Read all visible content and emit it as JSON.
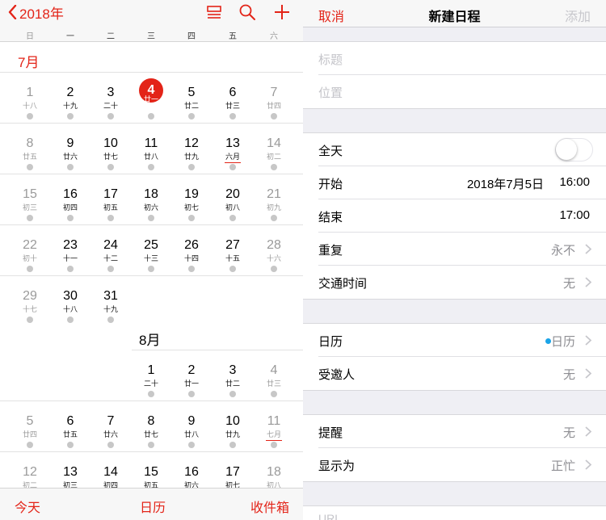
{
  "calendar": {
    "back_label": "2018年",
    "accent": "#e32418",
    "weekdays": [
      "日",
      "一",
      "二",
      "三",
      "四",
      "五",
      "六"
    ],
    "months": {
      "jul": "7月",
      "aug": "8月"
    },
    "july": [
      {
        "n": "1",
        "l": "十八"
      },
      {
        "n": "2",
        "l": "十九"
      },
      {
        "n": "3",
        "l": "二十"
      },
      {
        "n": "4",
        "l": "廿一"
      },
      {
        "n": "5",
        "l": "廿二"
      },
      {
        "n": "6",
        "l": "廿三"
      },
      {
        "n": "7",
        "l": "廿四"
      },
      {
        "n": "8",
        "l": "廿五"
      },
      {
        "n": "9",
        "l": "廿六"
      },
      {
        "n": "10",
        "l": "廿七"
      },
      {
        "n": "11",
        "l": "廿八"
      },
      {
        "n": "12",
        "l": "廿九"
      },
      {
        "n": "13",
        "l": "六月"
      },
      {
        "n": "14",
        "l": "初二"
      },
      {
        "n": "15",
        "l": "初三"
      },
      {
        "n": "16",
        "l": "初四"
      },
      {
        "n": "17",
        "l": "初五"
      },
      {
        "n": "18",
        "l": "初六"
      },
      {
        "n": "19",
        "l": "初七"
      },
      {
        "n": "20",
        "l": "初八"
      },
      {
        "n": "21",
        "l": "初九"
      },
      {
        "n": "22",
        "l": "初十"
      },
      {
        "n": "23",
        "l": "十一"
      },
      {
        "n": "24",
        "l": "十二"
      },
      {
        "n": "25",
        "l": "十三"
      },
      {
        "n": "26",
        "l": "十四"
      },
      {
        "n": "27",
        "l": "十五"
      },
      {
        "n": "28",
        "l": "十六"
      },
      {
        "n": "29",
        "l": "十七"
      },
      {
        "n": "30",
        "l": "十八"
      },
      {
        "n": "31",
        "l": "十九"
      }
    ],
    "august": [
      {
        "n": "1",
        "l": "二十"
      },
      {
        "n": "2",
        "l": "廿一"
      },
      {
        "n": "3",
        "l": "廿二"
      },
      {
        "n": "4",
        "l": "廿三"
      },
      {
        "n": "5",
        "l": "廿四"
      },
      {
        "n": "6",
        "l": "廿五"
      },
      {
        "n": "7",
        "l": "廿六"
      },
      {
        "n": "8",
        "l": "廿七"
      },
      {
        "n": "9",
        "l": "廿八"
      },
      {
        "n": "10",
        "l": "廿九"
      },
      {
        "n": "11",
        "l": "七月"
      },
      {
        "n": "12",
        "l": "初二"
      },
      {
        "n": "13",
        "l": "初三"
      },
      {
        "n": "14",
        "l": "初四"
      },
      {
        "n": "15",
        "l": "初五"
      },
      {
        "n": "16",
        "l": "初六"
      },
      {
        "n": "17",
        "l": "初七"
      },
      {
        "n": "18",
        "l": "初八"
      }
    ],
    "today": "4",
    "tabs": {
      "today": "今天",
      "calendars": "日历",
      "inbox": "收件箱"
    }
  },
  "form": {
    "cancel": "取消",
    "title": "新建日程",
    "add": "添加",
    "title_placeholder": "标题",
    "location_placeholder": "位置",
    "all_day": "全天",
    "starts": {
      "label": "开始",
      "date": "2018年7月5日",
      "time": "16:00"
    },
    "ends": {
      "label": "结束",
      "time": "17:00"
    },
    "repeat": {
      "label": "重复",
      "value": "永不"
    },
    "travel": {
      "label": "交通时间",
      "value": "无"
    },
    "calendar": {
      "label": "日历",
      "value": "日历",
      "dot_color": "#1aa4e8"
    },
    "invitees": {
      "label": "受邀人",
      "value": "无"
    },
    "alert": {
      "label": "提醒",
      "value": "无"
    },
    "show_as": {
      "label": "显示为",
      "value": "正忙"
    },
    "url_placeholder": "URL"
  }
}
